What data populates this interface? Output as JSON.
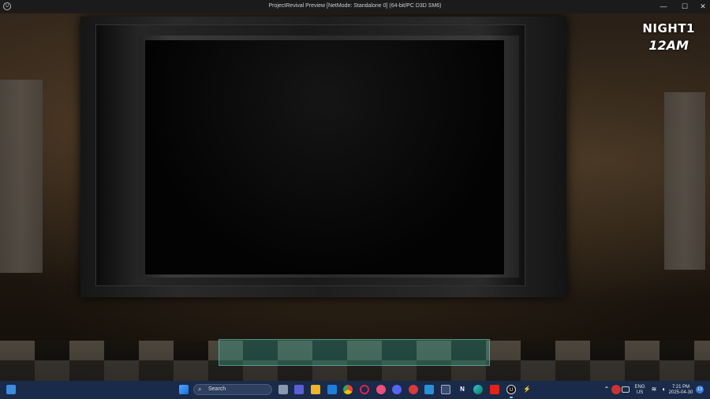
{
  "window": {
    "title": "ProjectRevival Preview [NetMode: Standalone 0]  (64-bit/PC D3D SM6)",
    "app_icon": "unreal-engine-icon",
    "minimize_glyph": "—",
    "maximize_glyph": "☐",
    "close_glyph": "✕"
  },
  "hud": {
    "night": "NIGHT1",
    "time": "12AM"
  },
  "scene": {
    "camera_toggle_color": "#40BEAA"
  },
  "taskbar": {
    "search_placeholder": "Search",
    "language": "ENG",
    "region": "US",
    "clock_time": "7:21 PM",
    "clock_date": "2025-04-30",
    "notification_count": "13",
    "pinned_icons": [
      "start-icon",
      "task-view-icon",
      "meet-icon",
      "file-explorer-icon",
      "outlook-icon",
      "chrome-icon",
      "opera-icon",
      "music-icon",
      "discord-icon",
      "app-red-icon",
      "photos-icon",
      "ms-store-icon",
      "notion-icon",
      "edge-icon",
      "youtube-icon",
      "unreal-engine-icon",
      "bolt-icon"
    ]
  }
}
